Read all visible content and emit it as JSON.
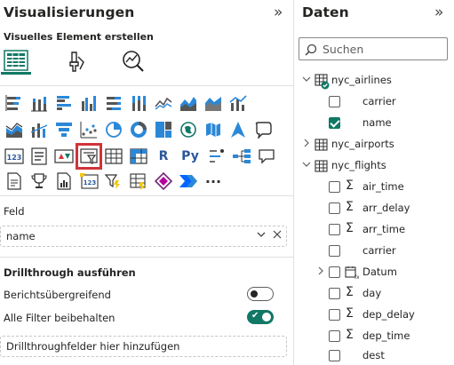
{
  "viz_pane": {
    "title": "Visualisierungen",
    "collapse_icon": "chevron-double-right",
    "subtitle": "Visuelles Element erstellen",
    "top_icons": [
      {
        "name": "build-visual-icon",
        "active": true
      },
      {
        "name": "format-visual-icon",
        "active": false
      },
      {
        "name": "analytics-icon",
        "active": false
      }
    ],
    "visual_icons": [
      [
        "stacked-bar-chart",
        "stacked-column-chart",
        "clustered-bar-chart",
        "clustered-column-chart",
        "100-percent-bar-chart",
        "100-percent-column-chart",
        "line-chart",
        "area-chart",
        "stacked-area-chart",
        "line-and-column-chart"
      ],
      [
        "line-and-stacked-column-chart",
        "ribbon-chart",
        "waterfall-chart",
        "funnel-chart",
        "scatter-chart",
        "pie-chart",
        "donut-chart",
        "treemap",
        "map",
        "filled-map"
      ],
      [
        "azure-map",
        "shape-map",
        "gauge",
        "card",
        "multi-row-card",
        "kpi",
        "slicer",
        "table",
        "matrix",
        "r-visual"
      ],
      [
        "python-visual",
        "key-influencers",
        "decomposition-tree",
        "qna",
        "smart-narrative",
        "paginated-report",
        "power-apps",
        "power-automate",
        "more-visuals"
      ]
    ],
    "visual_texts": {
      "r_visual": "R",
      "python_visual": "Py",
      "card": "123",
      "more": "···"
    },
    "field_section_label": "Feld",
    "field_well_value": "name",
    "drillthrough_label": "Drillthrough ausführen",
    "cross_report_label": "Berichtsübergreifend",
    "cross_report_on": false,
    "keep_filters_label": "Alle Filter beibehalten",
    "keep_filters_on": true,
    "drillthrough_fields_placeholder": "Drillthroughfelder hier hinzufügen",
    "accent_color": "#117865",
    "selection_color": "#d13438"
  },
  "data_pane": {
    "title": "Daten",
    "collapse_icon": "chevron-double-right",
    "search_placeholder": "Suchen",
    "tables": [
      {
        "name": "nyc_airlines",
        "expanded": true,
        "has_selection": true,
        "fields": [
          {
            "name": "carrier",
            "type": "text",
            "checked": false
          },
          {
            "name": "name",
            "type": "text",
            "checked": true
          }
        ]
      },
      {
        "name": "nyc_airports",
        "expanded": false,
        "has_selection": false,
        "fields": []
      },
      {
        "name": "nyc_flights",
        "expanded": true,
        "has_selection": false,
        "fields": [
          {
            "name": "air_time",
            "type": "sum",
            "checked": false
          },
          {
            "name": "arr_delay",
            "type": "sum",
            "checked": false
          },
          {
            "name": "arr_time",
            "type": "sum",
            "checked": false
          },
          {
            "name": "carrier",
            "type": "text",
            "checked": false
          },
          {
            "name": "Datum",
            "type": "date-hierarchy",
            "checked": false
          },
          {
            "name": "day",
            "type": "sum",
            "checked": false
          },
          {
            "name": "dep_delay",
            "type": "sum",
            "checked": false
          },
          {
            "name": "dep_time",
            "type": "sum",
            "checked": false
          },
          {
            "name": "dest",
            "type": "text",
            "checked": false
          }
        ]
      }
    ]
  }
}
